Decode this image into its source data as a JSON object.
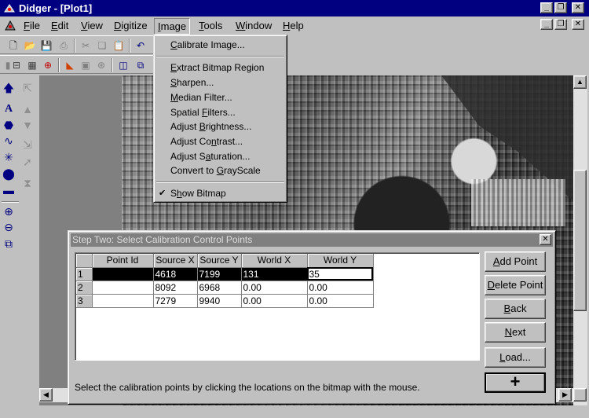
{
  "window": {
    "title": "Didger - [Plot1]",
    "minimize_glyph": "_",
    "restore_glyph": "❐",
    "close_glyph": "✕"
  },
  "menubar": {
    "items": [
      "File",
      "Edit",
      "View",
      "Digitize",
      "Image",
      "Tools",
      "Window",
      "Help"
    ],
    "active": "Image"
  },
  "image_menu": {
    "items": [
      {
        "label": "Calibrate Image...",
        "group": 1
      },
      {
        "label": "Extract Bitmap Region",
        "group": 2
      },
      {
        "label": "Sharpen...",
        "group": 2
      },
      {
        "label": "Median Filter...",
        "group": 2
      },
      {
        "label": "Spatial Filters...",
        "group": 2
      },
      {
        "label": "Adjust Brightness...",
        "group": 2
      },
      {
        "label": "Adjust Contrast...",
        "group": 2
      },
      {
        "label": "Adjust Saturation...",
        "group": 2
      },
      {
        "label": "Convert to GrayScale",
        "group": 2
      },
      {
        "label": "Show Bitmap",
        "group": 3,
        "checked": true
      }
    ],
    "check_glyph": "✔"
  },
  "dialog": {
    "title": "Step Two: Select Calibration Control Points",
    "columns": [
      "",
      "Point Id",
      "Source X",
      "Source Y",
      "World X",
      "World Y"
    ],
    "rows": [
      {
        "num": "1",
        "id": "",
        "sx": "4618",
        "sy": "7199",
        "wx": "131",
        "wy": "35"
      },
      {
        "num": "2",
        "id": "",
        "sx": "8092",
        "sy": "6968",
        "wx": "0.00",
        "wy": "0.00"
      },
      {
        "num": "3",
        "id": "",
        "sx": "7279",
        "sy": "9940",
        "wx": "0.00",
        "wy": "0.00"
      }
    ],
    "buttons": {
      "add": "Add Point",
      "delete": "Delete Point",
      "back": "Back",
      "next": "Next",
      "load": "Load...",
      "plus": "+"
    },
    "status": "Select the calibration points by clicking the locations on the bitmap with the mouse."
  },
  "colors": {
    "titlebar": "#000080",
    "dialog_titlebar_inactive": "#808080",
    "selection": "#000000",
    "face": "#c0c0c0"
  }
}
